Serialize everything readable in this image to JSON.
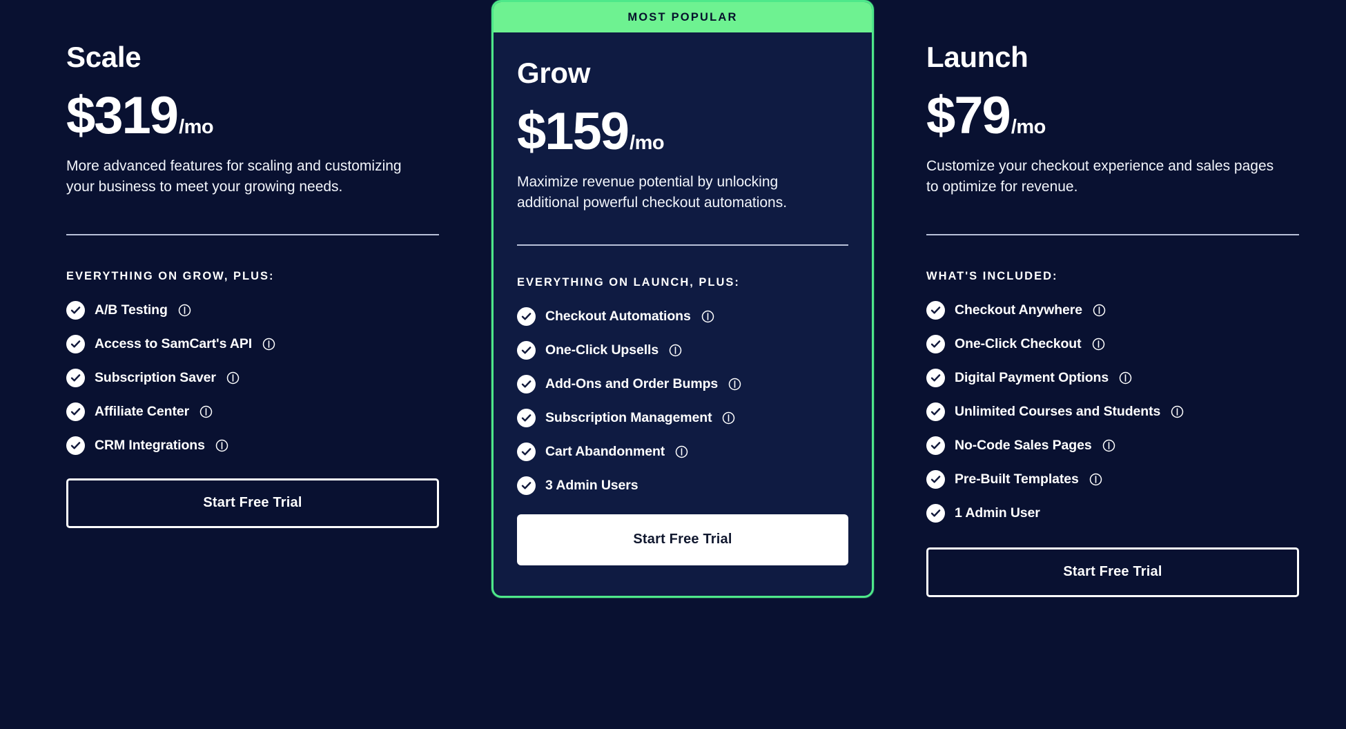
{
  "page": {
    "background_color": "#091131",
    "accent_green": "#6ef291",
    "card_background": "#0f1b42",
    "text_color": "#ffffff"
  },
  "plans": [
    {
      "id": "scale",
      "name": "Scale",
      "price": "$319",
      "period": "/mo",
      "description": "More advanced features for scaling and customizing your business to meet your growing needs.",
      "features_label": "EVERYTHING ON GROW, PLUS:",
      "cta_label": "Start Free Trial",
      "cta_style": "outline",
      "badge": null,
      "features": [
        {
          "label": "A/B Testing",
          "info": true
        },
        {
          "label": "Access to SamCart's API",
          "info": true
        },
        {
          "label": "Subscription Saver",
          "info": true
        },
        {
          "label": "Affiliate Center",
          "info": true
        },
        {
          "label": "CRM Integrations",
          "info": true
        }
      ]
    },
    {
      "id": "grow",
      "name": "Grow",
      "price": "$159",
      "period": "/mo",
      "description": "Maximize revenue potential by unlocking additional powerful checkout automations.",
      "features_label": "EVERYTHING ON LAUNCH, PLUS:",
      "cta_label": "Start Free Trial",
      "cta_style": "solid",
      "badge": "MOST POPULAR",
      "features": [
        {
          "label": "Checkout Automations",
          "info": true
        },
        {
          "label": "One-Click Upsells",
          "info": true
        },
        {
          "label": "Add-Ons and Order Bumps",
          "info": true
        },
        {
          "label": "Subscription Management",
          "info": true
        },
        {
          "label": "Cart Abandonment",
          "info": true
        },
        {
          "label": "3 Admin Users",
          "info": false
        }
      ]
    },
    {
      "id": "launch",
      "name": "Launch",
      "price": "$79",
      "period": "/mo",
      "description": "Customize your checkout experience and sales pages to optimize for revenue.",
      "features_label": "WHAT'S INCLUDED:",
      "cta_label": "Start Free Trial",
      "cta_style": "outline",
      "badge": null,
      "features": [
        {
          "label": "Checkout Anywhere",
          "info": true
        },
        {
          "label": "One-Click Checkout",
          "info": true
        },
        {
          "label": "Digital Payment Options",
          "info": true
        },
        {
          "label": "Unlimited Courses and Students",
          "info": true
        },
        {
          "label": "No-Code Sales Pages",
          "info": true
        },
        {
          "label": "Pre-Built Templates",
          "info": true
        },
        {
          "label": "1 Admin User",
          "info": false
        }
      ]
    }
  ],
  "icons": {
    "check": "check-circle-icon",
    "info": "info-icon"
  }
}
